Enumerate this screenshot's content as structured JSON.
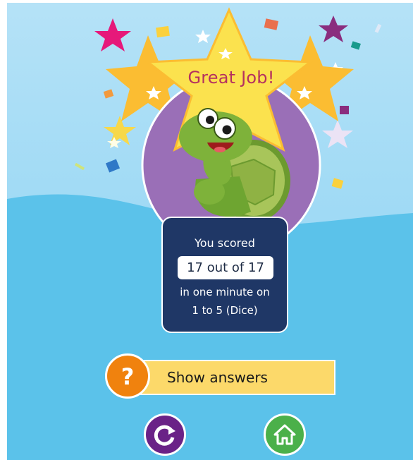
{
  "header": {
    "title": "Great Job!"
  },
  "result": {
    "line1": "You scored",
    "score": "17 out of 17",
    "line3": "in one minute on",
    "line4": "1 to 5 (Dice)"
  },
  "actions": {
    "show_answers_label": "Show answers",
    "help_icon": "question-mark-icon",
    "retry_icon": "refresh-icon",
    "home_icon": "home-icon"
  },
  "colors": {
    "title": "#b5315f",
    "score_card": "#1f3766",
    "show_answers_bg": "#fcd96a",
    "help_button": "#f0820e",
    "retry_button": "#6a2287",
    "home_button": "#4bb04a"
  }
}
